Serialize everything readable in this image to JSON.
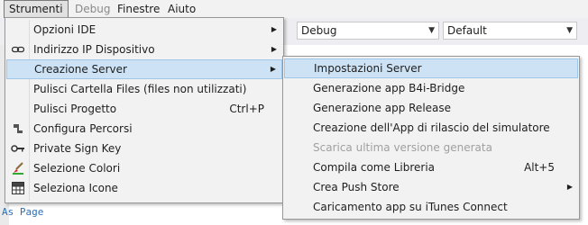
{
  "menubar": [
    {
      "label": "Strumenti",
      "active": true
    },
    {
      "label": "Debug",
      "disabled": true
    },
    {
      "label": "Finestre"
    },
    {
      "label": "Aiuto"
    }
  ],
  "toolbar": {
    "config_combo": "Debug",
    "target_combo": "Default"
  },
  "editor": {
    "line_last": "As Page"
  },
  "main_menu": [
    {
      "label": "Opzioni IDE",
      "icon": "none",
      "submenu": true
    },
    {
      "label": "Indirizzo IP Dispositivo",
      "icon": "link-icon",
      "submenu": true
    },
    {
      "label": "Creazione Server",
      "icon": "none",
      "submenu": true,
      "highlighted": true
    },
    {
      "label": "Pulisci Cartella Files (files non utilizzati)",
      "icon": "none"
    },
    {
      "label": "Pulisci Progetto",
      "icon": "none",
      "shortcut": "Ctrl+P"
    },
    {
      "label": "Configura Percorsi",
      "icon": "wrench-icon"
    },
    {
      "label": "Private Sign Key",
      "icon": "key-icon"
    },
    {
      "label": "Selezione Colori",
      "icon": "paint-brush-icon"
    },
    {
      "label": "Seleziona Icone",
      "icon": "grid-icon"
    }
  ],
  "sub_menu": [
    {
      "label": "Impostazioni Server",
      "highlighted": true
    },
    {
      "label": "Generazione app B4i-Bridge"
    },
    {
      "label": "Generazione app Release"
    },
    {
      "label": "Creazione dell'App di rilascio del simulatore"
    },
    {
      "label": "Scarica ultima versione generata",
      "disabled": true
    },
    {
      "label": "Compila come Libreria",
      "shortcut": "Alt+5"
    },
    {
      "label": "Crea Push Store",
      "submenu": true
    },
    {
      "label": "Caricamento app su iTunes Connect"
    }
  ]
}
